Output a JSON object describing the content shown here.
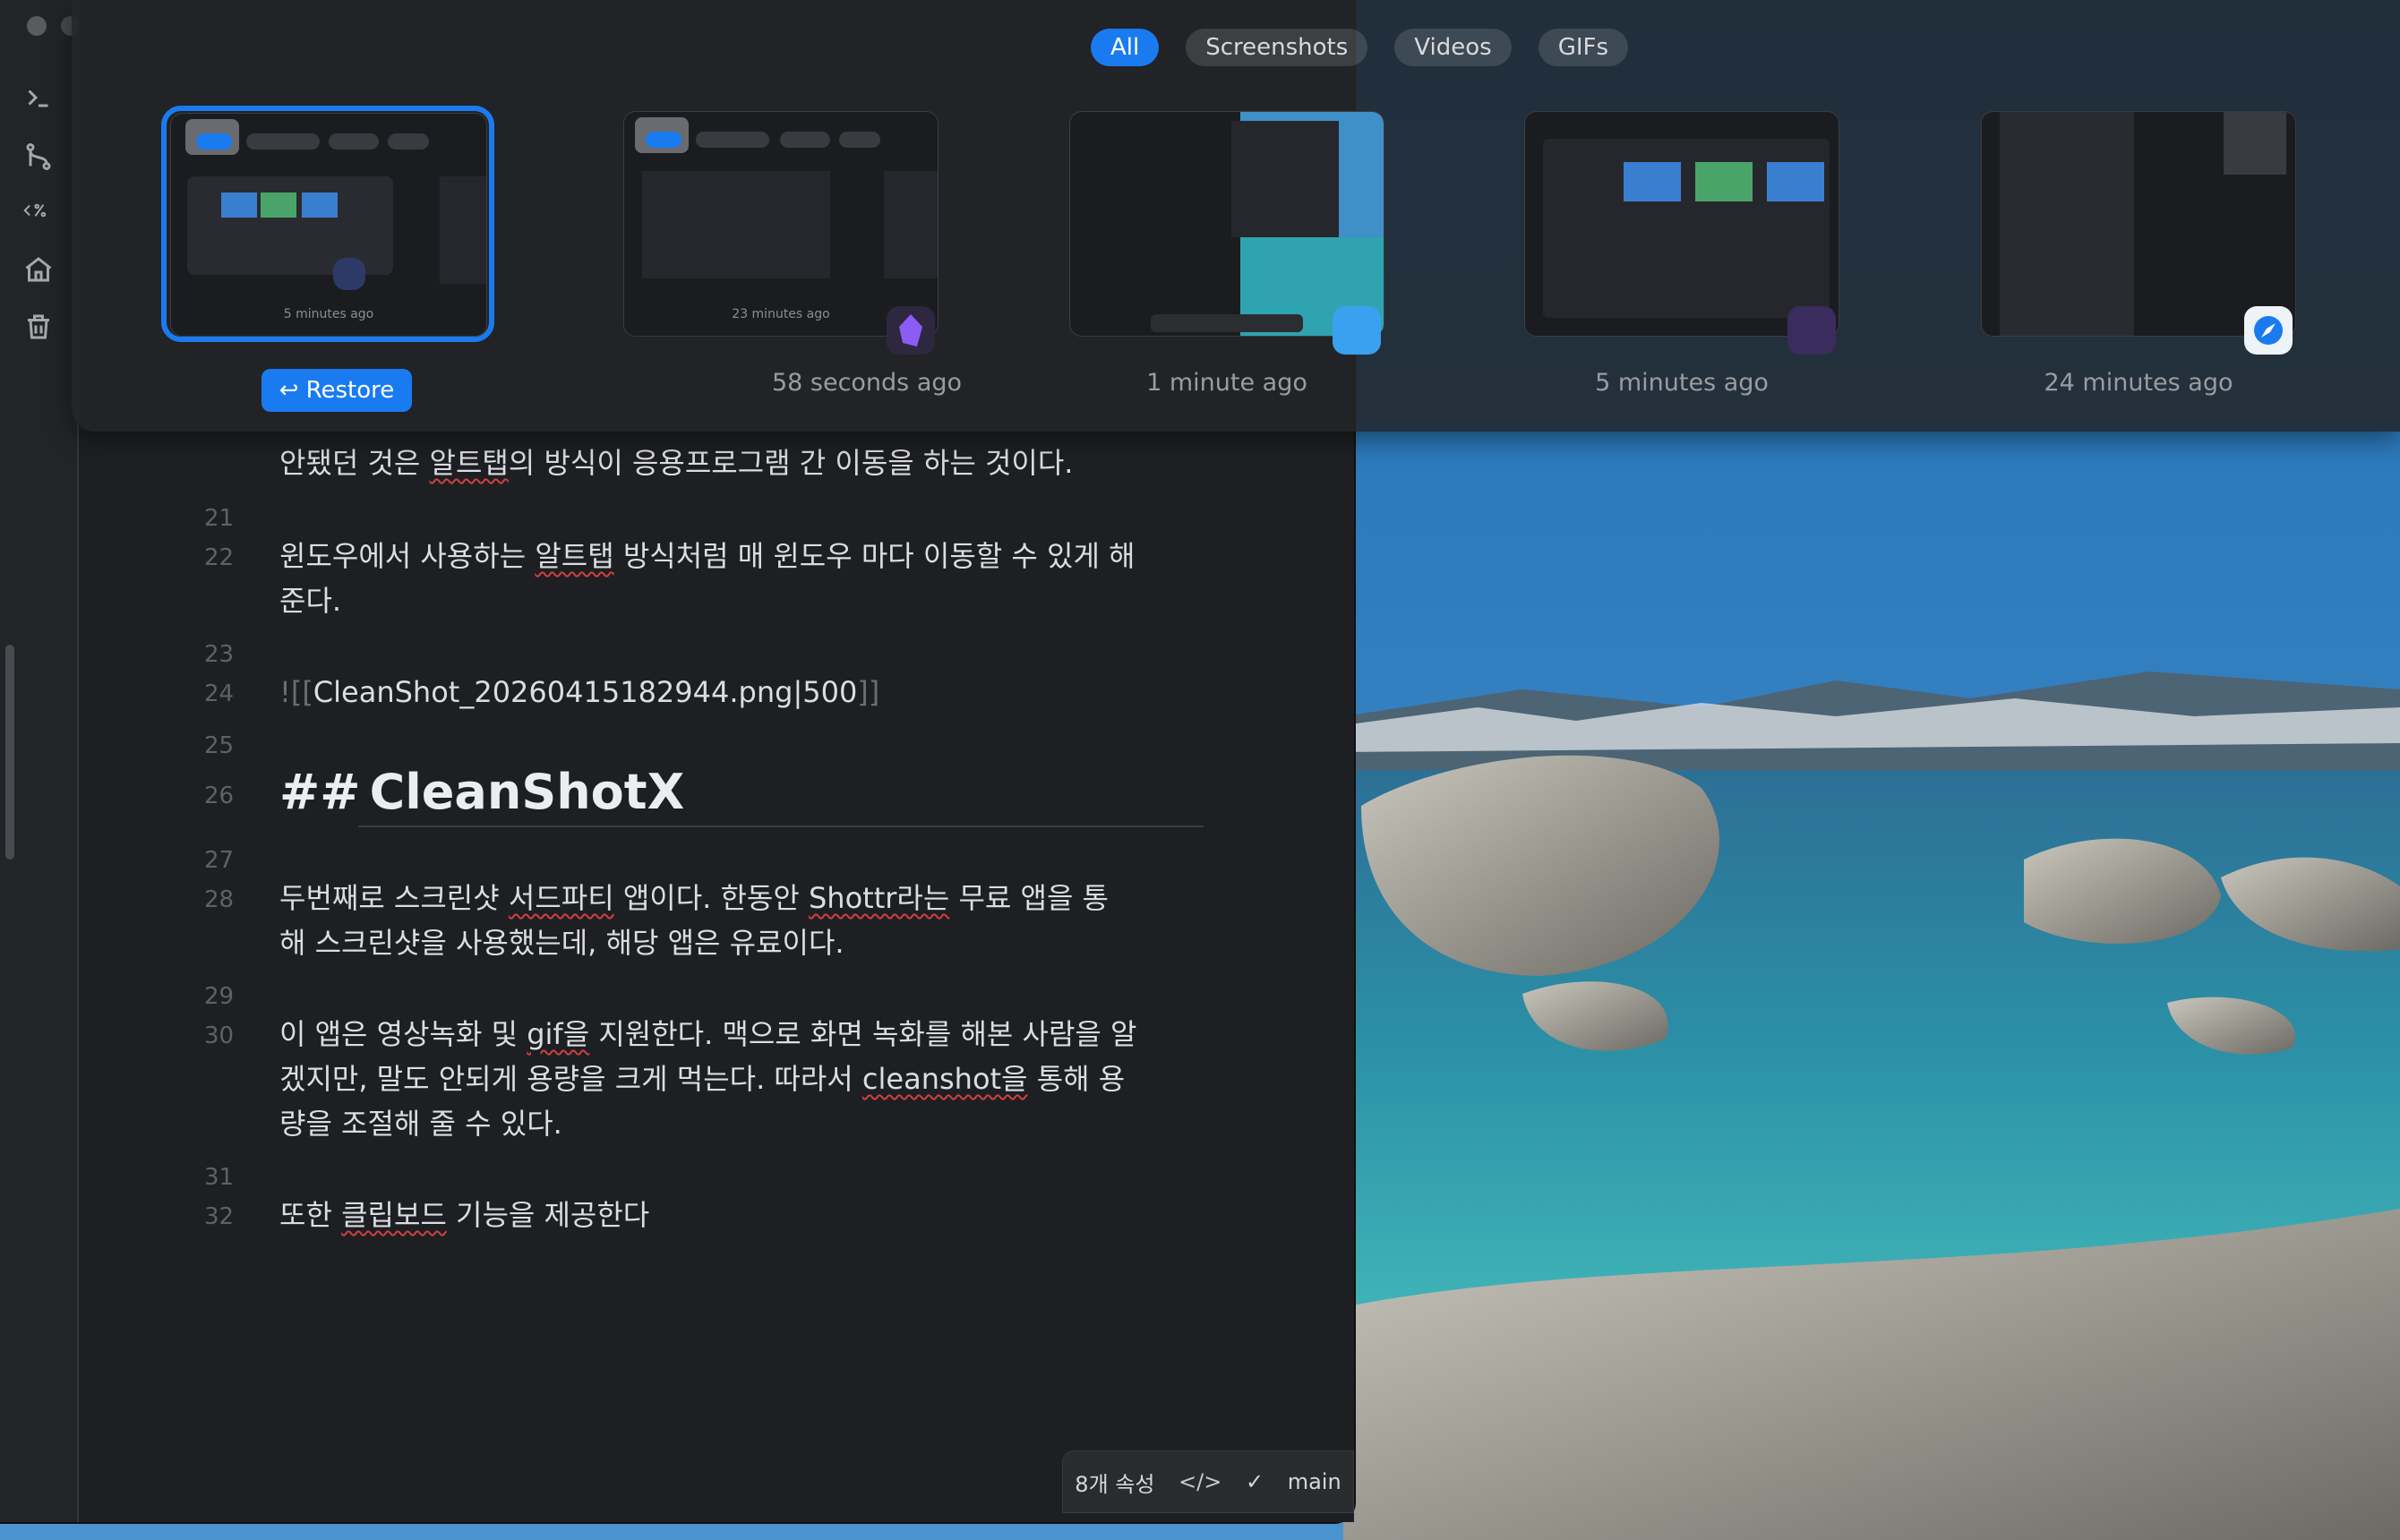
{
  "switcher": {
    "filters": [
      {
        "label": "All",
        "active": true
      },
      {
        "label": "Screenshots",
        "active": false
      },
      {
        "label": "Videos",
        "active": false
      },
      {
        "label": "GIFs",
        "active": false
      }
    ],
    "restore_label": "Restore",
    "cards": [
      {
        "time": "5 minutes ago",
        "thumb_time": "5 minutes ago",
        "selected": true,
        "app_icon": "cleanshot-icon"
      },
      {
        "time": "58 seconds ago",
        "thumb_time": "23 minutes ago",
        "selected": false,
        "app_icon": "obsidian-icon"
      },
      {
        "time": "1 minute ago",
        "thumb_time": "",
        "selected": false,
        "app_icon": "finder-icon"
      },
      {
        "time": "5 minutes ago",
        "thumb_time": "",
        "selected": false,
        "app_icon": "cleanshot-icon"
      },
      {
        "time": "24 minutes ago",
        "thumb_time": "",
        "selected": false,
        "app_icon": "safari-icon"
      }
    ],
    "thumb_chips": [
      "All",
      "Screenshots",
      "Videos",
      "GIFs"
    ],
    "thumb_extra_time": "23"
  },
  "editor": {
    "lines": [
      {
        "num": "",
        "text": "안됐던 것은 알트탭의 방식이 응용프로그램 간 이동을 하는 것이다."
      },
      {
        "num": "21",
        "text": ""
      },
      {
        "num": "22",
        "text": "윈도우에서 사용하는 알트탭 방식처럼 매 윈도우 마다 이동할 수 있게 해"
      },
      {
        "num": "",
        "text": "준다."
      },
      {
        "num": "23",
        "text": ""
      },
      {
        "num": "24",
        "text": "CleanShot_20260415182944.png|500"
      },
      {
        "num": "25",
        "text": ""
      },
      {
        "num": "26",
        "text": "CleanShotX"
      },
      {
        "num": "27",
        "text": ""
      },
      {
        "num": "28",
        "text": "두번째로 스크린샷 서드파티 앱이다. 한동안 Shottr라는 무료 앱을 통"
      },
      {
        "num": "",
        "text": "해 스크린샷을 사용했는데, 해당 앱은 유료이다."
      },
      {
        "num": "29",
        "text": ""
      },
      {
        "num": "30",
        "text": "이 앱은 영상녹화 및 gif을 지원한다. 맥으로 화면 녹화를 해본 사람을 알"
      },
      {
        "num": "",
        "text": "겠지만, 말도 안되게 용량을 크게 먹는다. 따라서 cleanshot을 통해 용"
      },
      {
        "num": "",
        "text": "량을 조절해 줄 수 있다."
      },
      {
        "num": "31",
        "text": ""
      },
      {
        "num": "32",
        "text": "또한 클립보드 기능을 제공한다"
      }
    ],
    "heading_marker": "##",
    "embed_open": "![[",
    "embed_close": "]]",
    "status": {
      "properties": "8개 속성",
      "branch": "main"
    }
  },
  "colors": {
    "accent": "#1a7bf0",
    "editor_bg": "#1e1f22",
    "text": "#dcdde0"
  }
}
